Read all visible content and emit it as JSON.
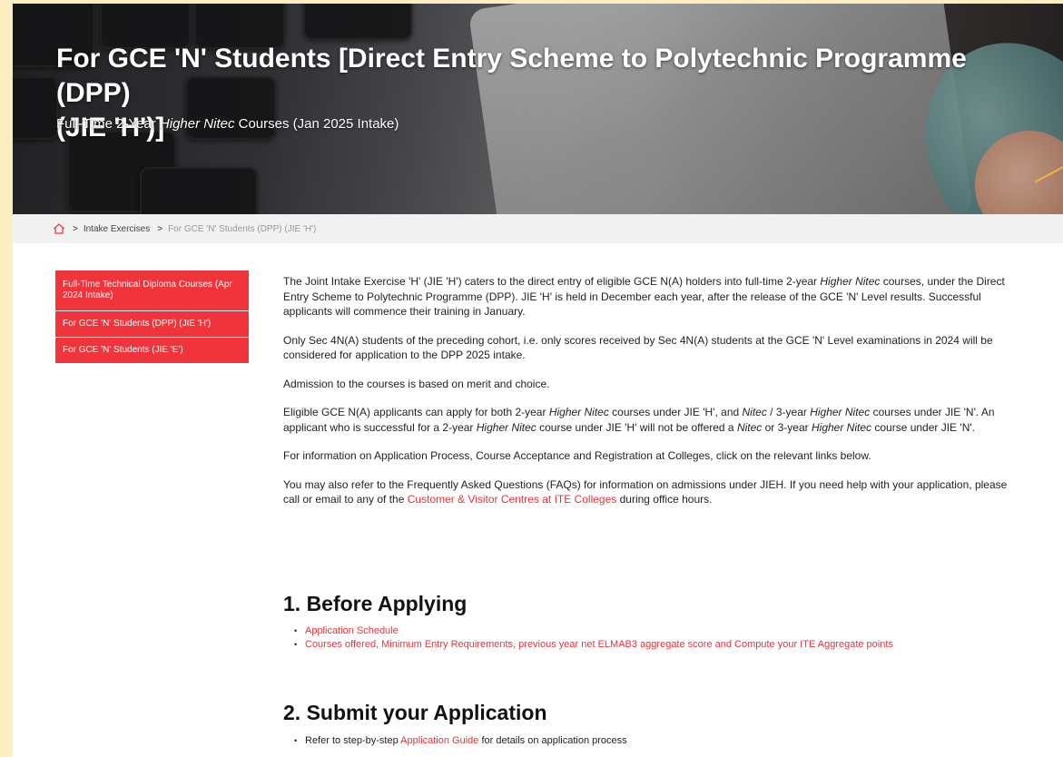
{
  "hero": {
    "title_line1": "For GCE 'N' Students [Direct Entry Scheme to Polytechnic Programme (DPP)",
    "title_line2": "(JIE 'H')]",
    "subtitle_pre": "Full-Time 2-Year ",
    "subtitle_italic": "Higher Nitec",
    "subtitle_post": " Courses (Jan 2025 Intake)"
  },
  "breadcrumb": {
    "home_icon": "home-icon",
    "separator": ">",
    "link": "Intake Exercises",
    "current": "For GCE 'N' Students (DPP) (JIE 'H')"
  },
  "sidebar": {
    "items": [
      {
        "label": "Full-Time Technical Diploma Courses (Apr 2024 Intake)"
      },
      {
        "label": "For GCE 'N' Students (DPP) (JIE 'H')"
      },
      {
        "label": "For GCE 'N' Students (JIE 'E')"
      }
    ]
  },
  "content": {
    "p1_a": "The Joint Intake Exercise 'H' (JIE 'H') caters to the direct entry of eligible GCE N(A) holders into full-time 2-year ",
    "p1_italic": "Higher Nitec",
    "p1_b": " courses, under the Direct Entry Scheme to Polytechnic Programme (DPP). JIE 'H' is held in December each year, after the release of the GCE 'N' Level results. Successful applicants will commence their training in January.",
    "p2": "Only Sec 4N(A) students of the preceding cohort, i.e. only scores received by Sec 4N(A) students at the GCE 'N' Level examinations in 2024 will be considered for application to the DPP 2025 intake.",
    "p3": "Admission to the courses is based on merit and choice.",
    "p4_a": "Eligible GCE N(A) applicants can apply for both 2-year ",
    "p4_i1": "Higher Nitec",
    "p4_b": " courses under JIE 'H', and ",
    "p4_i2": "Nitec",
    "p4_c": " / 3-year ",
    "p4_i3": "Higher Nitec",
    "p4_d": " courses under JIE 'N'. An applicant who is successful for a 2-year ",
    "p4_i4": "Higher Nitec",
    "p4_e": " course under JIE 'H' will not be offered a ",
    "p4_i5": "Nitec",
    "p4_f": " or 3-year ",
    "p4_i6": "Higher Nitec",
    "p4_g": " course under JIE 'N'.",
    "p5": "For information on Application Process, Course Acceptance and Registration at Colleges, click on the relevant links below.",
    "p6_a": "You may also refer to the Frequently Asked Questions (FAQs) for information on admissions under JIEH. If you need help with your application, please call or email to any of the ",
    "p6_link": "Customer & Visitor Centres at ITE Colleges",
    "p6_b": " during office hours."
  },
  "section1": {
    "heading": "1. Before Applying",
    "links": [
      "Application Schedule",
      "Courses offered, Minimum Entry Requirements, previous year net ELMAB3 aggregate score and Compute your ITE Aggregate points"
    ]
  },
  "section2": {
    "heading": "2. Submit your Application",
    "item_pre": "Refer to step-by-step ",
    "item_link": "Application Guide",
    "item_post": " for details on application process"
  },
  "colors": {
    "accent": "#f0343c",
    "link": "#e8323a",
    "frame": "#fbeec1"
  }
}
